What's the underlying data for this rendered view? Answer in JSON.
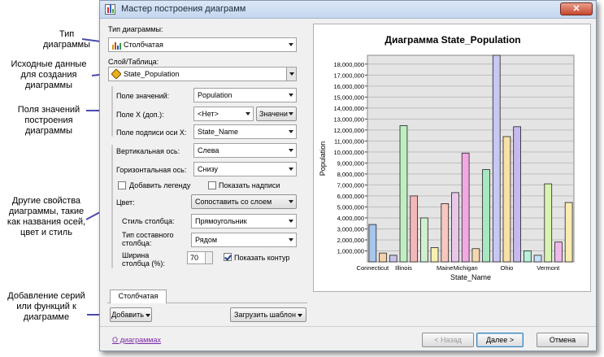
{
  "callouts": {
    "chart_type": "Тип\nдиаграммы",
    "source_data": "Исходные данные\nдля создания\nдиаграммы",
    "value_fields": "Поля значений\nпостроения\nдиаграммы",
    "other_props": "Другие свойства\nдиаграммы, такие\nкак названия осей,\nцвет и стиль",
    "add_series": "Добавление серий\nили функций к\nдиаграмме"
  },
  "window": {
    "title": "Мастер построения диаграмм",
    "close_glyph": "✕"
  },
  "form": {
    "chart_type_label": "Тип диаграммы:",
    "chart_type_value": "Столбчатая",
    "layer_label": "Слой/Таблица:",
    "layer_value": "State_Population",
    "value_field_label": "Поле значений:",
    "value_field_value": "Population",
    "x_field_label": "Поле X (доп.):",
    "x_field_value": "<Нет>",
    "x_field_sort": "Значени",
    "x_label_field_label": "Поле подписи оси X:",
    "x_label_field_value": "State_Name",
    "vertical_axis_label": "Вертикальная ось:",
    "vertical_axis_value": "Слева",
    "horizontal_axis_label": "Горизонтальная ось:",
    "horizontal_axis_value": "Снизу",
    "add_legend_label": "Добавить легенду",
    "show_labels_label": "Показать надписи",
    "color_label": "Цвет:",
    "color_value": "Сопоставить со слоем",
    "bar_style_label": "Стиль столбца:",
    "bar_style_value": "Прямоугольник",
    "multibar_type_label": "Тип составного\nстолбца:",
    "multibar_type_value": "Рядом",
    "bar_width_label": "Ширина\nстолбца (%):",
    "bar_width_value": "70",
    "show_outline_label": "Показать контур"
  },
  "tabs": {
    "series_tab": "Столбчатая"
  },
  "buttons": {
    "add": "Добавить",
    "load_template": "Загрузить шаблон",
    "about_link": "О диаграммах",
    "back": "< Назад",
    "next": "Далее >",
    "cancel": "Отмена"
  },
  "colors": {
    "accent": "#3c7fb1",
    "callout_line": "#4a4ab0",
    "close_red": "#c7452c"
  },
  "chart_data": {
    "type": "bar",
    "title": "Диаграмма  State_Population",
    "xlabel": "State_Name",
    "ylabel": "Population",
    "ylim": [
      0,
      18800000
    ],
    "yticks": [
      1000000,
      2000000,
      3000000,
      4000000,
      5000000,
      6000000,
      7000000,
      8000000,
      9000000,
      10000000,
      11000000,
      12000000,
      13000000,
      14000000,
      15000000,
      16000000,
      17000000,
      18000000
    ],
    "ytick_labels": [
      "1,000,000",
      "2,000,000",
      "3,000,000",
      "4,000,000",
      "5,000,000",
      "6,000,000",
      "7,000,000",
      "8,000,000",
      "9,000,000",
      "10,000,000",
      "11,000,000",
      "12,000,000",
      "13,000,000",
      "14,000,000",
      "15,000,000",
      "16,000,000",
      "17,000,000",
      "18,000,000"
    ],
    "category_labels": [
      "Connecticut",
      "Illinois",
      "Maine",
      "Michigan",
      "Ohio",
      "Vermont"
    ],
    "values": [
      3400000,
      800000,
      600000,
      12400000,
      6000000,
      4000000,
      1300000,
      5300000,
      6300000,
      9900000,
      1200000,
      8400000,
      18800000,
      11400000,
      12300000,
      1000000,
      600000,
      7100000,
      1800000,
      5400000
    ],
    "bar_colors": [
      "#a7c6ee",
      "#f4d0a8",
      "#c9c1e8",
      "#bfeec0",
      "#f5b8b8",
      "#d0f0d0",
      "#f8f0b0",
      "#f6c8c0",
      "#e8c8e8",
      "#f2a8e0",
      "#f4d8b0",
      "#a8e8c0",
      "#c8c8f4",
      "#f8e0a8",
      "#c8b8f0",
      "#b8f0d8",
      "#c8e0f8",
      "#d8f4b0",
      "#f0b8e8",
      "#f8ecb0"
    ],
    "grid": true
  }
}
